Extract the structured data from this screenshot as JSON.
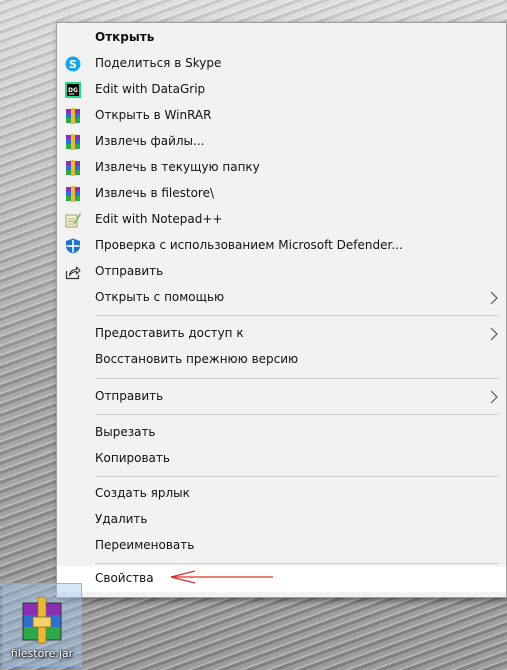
{
  "menu": {
    "items": [
      {
        "label": "Открыть",
        "icon": "none",
        "bold": true
      },
      {
        "label": "Поделиться в Skype",
        "icon": "skype-icon"
      },
      {
        "label": "Edit with DataGrip",
        "icon": "datagrip-icon"
      },
      {
        "label": "Открыть в WinRAR",
        "icon": "winrar-icon"
      },
      {
        "label": "Извлечь файлы...",
        "icon": "winrar-icon"
      },
      {
        "label": "Извлечь в текущую папку",
        "icon": "winrar-icon"
      },
      {
        "label": "Извлечь в filestore\\",
        "icon": "winrar-icon"
      },
      {
        "label": "Edit with Notepad++",
        "icon": "notepadpp-icon"
      },
      {
        "label": "Проверка с использованием Microsoft Defender...",
        "icon": "defender-icon"
      },
      {
        "label": "Отправить",
        "icon": "share-icon"
      },
      {
        "label": "Открыть с помощью",
        "icon": "none",
        "submenu": true
      },
      {
        "label": "Предоставить доступ к",
        "icon": "none",
        "submenu": true
      },
      {
        "label": "Восстановить прежнюю версию",
        "icon": "none"
      },
      {
        "label": "Отправить",
        "icon": "none",
        "submenu": true
      },
      {
        "label": "Вырезать",
        "icon": "none"
      },
      {
        "label": "Копировать",
        "icon": "none"
      },
      {
        "label": "Создать ярлык",
        "icon": "none"
      },
      {
        "label": "Удалить",
        "icon": "none"
      },
      {
        "label": "Переименовать",
        "icon": "none"
      },
      {
        "label": "Свойства",
        "icon": "none",
        "highlighted": true
      }
    ]
  },
  "desktop": {
    "file_name": "filestore.jar"
  },
  "colors": {
    "menu_bg": "#f2f2f2",
    "highlight_bg": "#ffffff",
    "annotation_arrow": "#d9302a",
    "skype": "#1aa3e8",
    "defender": "#1f73c9"
  }
}
